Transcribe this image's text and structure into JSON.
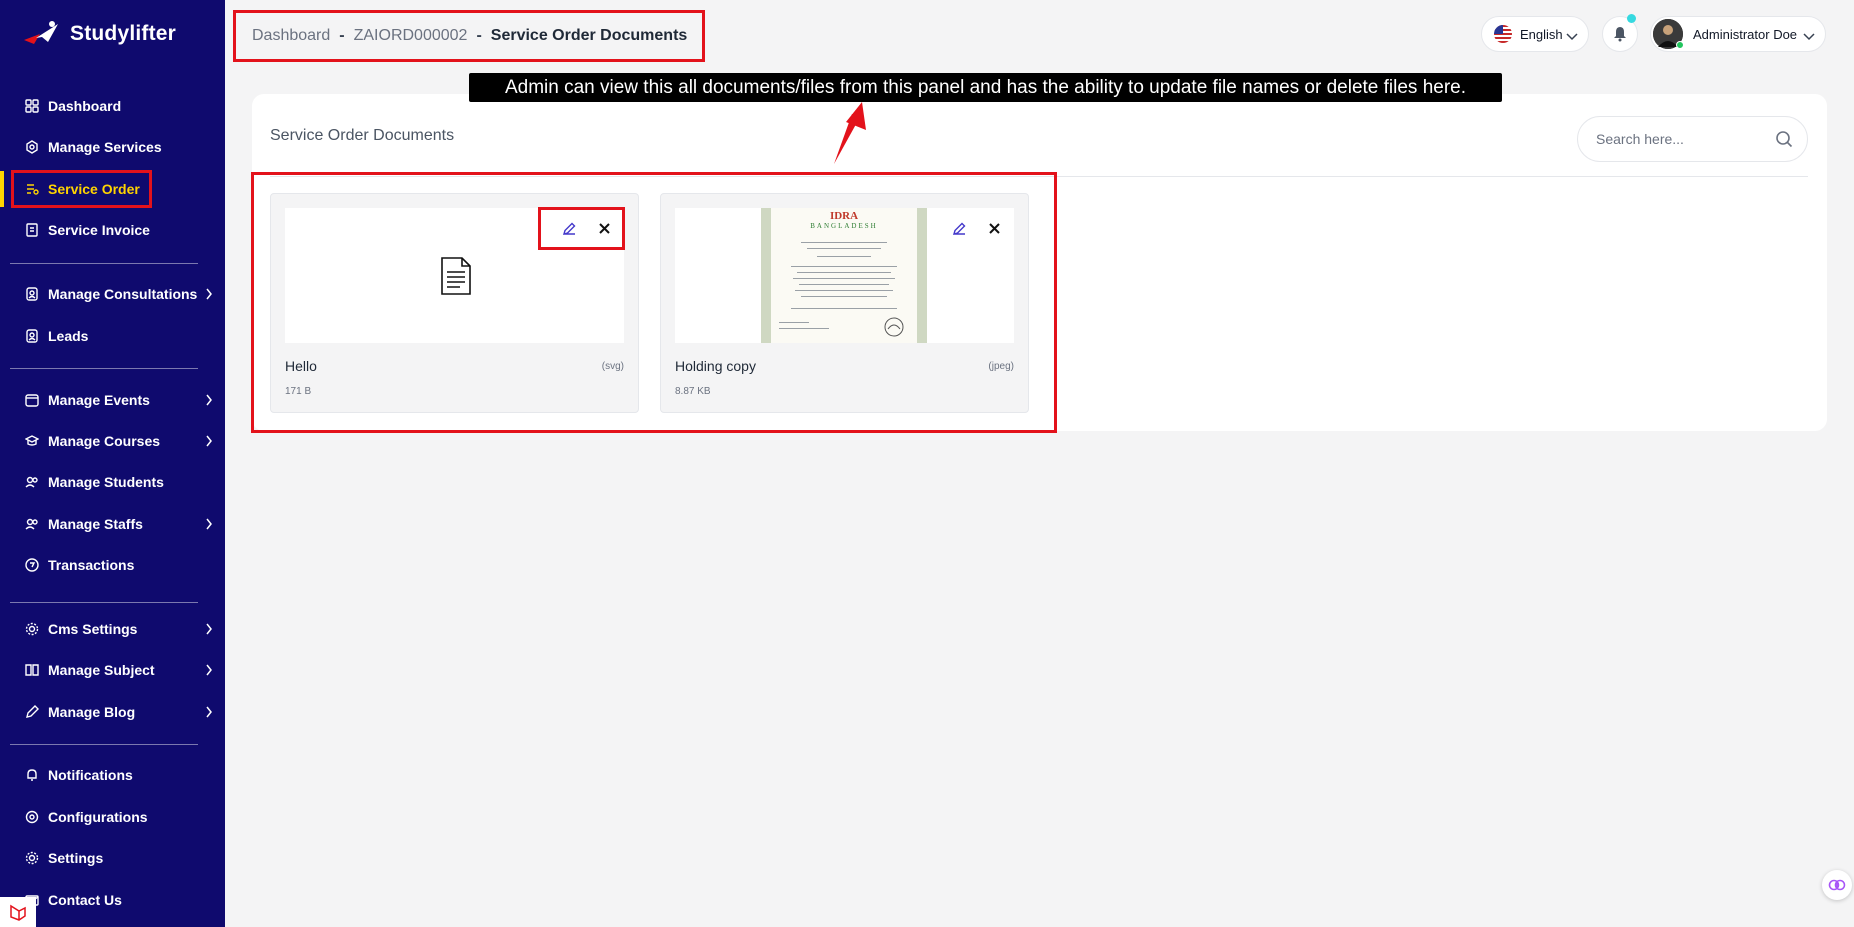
{
  "brand": {
    "name": "Studylifter"
  },
  "sidebar": {
    "items": [
      {
        "label": "Dashboard",
        "icon": "dashboard-icon",
        "has_children": false
      },
      {
        "label": "Manage Services",
        "icon": "services-icon",
        "has_children": false
      },
      {
        "label": "Service Order",
        "icon": "service-order-icon",
        "has_children": false,
        "active": true
      },
      {
        "label": "Service Invoice",
        "icon": "invoice-icon",
        "has_children": false
      },
      {
        "label": "Manage Consultations",
        "icon": "consultations-icon",
        "has_children": true
      },
      {
        "label": "Leads",
        "icon": "leads-icon",
        "has_children": false
      },
      {
        "label": "Manage Events",
        "icon": "events-icon",
        "has_children": true
      },
      {
        "label": "Manage Courses",
        "icon": "courses-icon",
        "has_children": true
      },
      {
        "label": "Manage Students",
        "icon": "students-icon",
        "has_children": false
      },
      {
        "label": "Manage Staffs",
        "icon": "staffs-icon",
        "has_children": true
      },
      {
        "label": "Transactions",
        "icon": "transactions-icon",
        "has_children": false
      },
      {
        "label": "Cms Settings",
        "icon": "cms-gear-icon",
        "has_children": true
      },
      {
        "label": "Manage Subject",
        "icon": "subject-icon",
        "has_children": true
      },
      {
        "label": "Manage Blog",
        "icon": "blog-icon",
        "has_children": true
      },
      {
        "label": "Notifications",
        "icon": "bell-icon",
        "has_children": false
      },
      {
        "label": "Configurations",
        "icon": "configurations-icon",
        "has_children": false
      },
      {
        "label": "Settings",
        "icon": "gear-icon",
        "has_children": false
      },
      {
        "label": "Contact Us",
        "icon": "contact-icon",
        "has_children": false
      }
    ]
  },
  "breadcrumb": {
    "items": [
      "Dashboard",
      "ZAIORD000002",
      "Service Order Documents"
    ],
    "separator": "-"
  },
  "header": {
    "language": "English",
    "user_name": "Administrator Doe"
  },
  "annotation": {
    "tooltip": "Admin can view this all documents/files from this panel and has the ability to update file names or delete files here."
  },
  "panel": {
    "title": "Service Order Documents",
    "search_placeholder": "Search here..."
  },
  "files": [
    {
      "name": "Hello",
      "ext": "(svg)",
      "size": "171 B",
      "preview": "document-icon"
    },
    {
      "name": "Holding copy",
      "ext": "(jpeg)",
      "size": "8.87 KB",
      "preview": "certificate-image",
      "preview_text": {
        "title": "IDRA",
        "subtitle": "BANGLADESH"
      }
    }
  ],
  "colors": {
    "sidebar_bg": "#0f0a6e",
    "active_text": "#ffd400",
    "highlight_red": "#e3121b",
    "accent_purple": "#4338ca"
  }
}
